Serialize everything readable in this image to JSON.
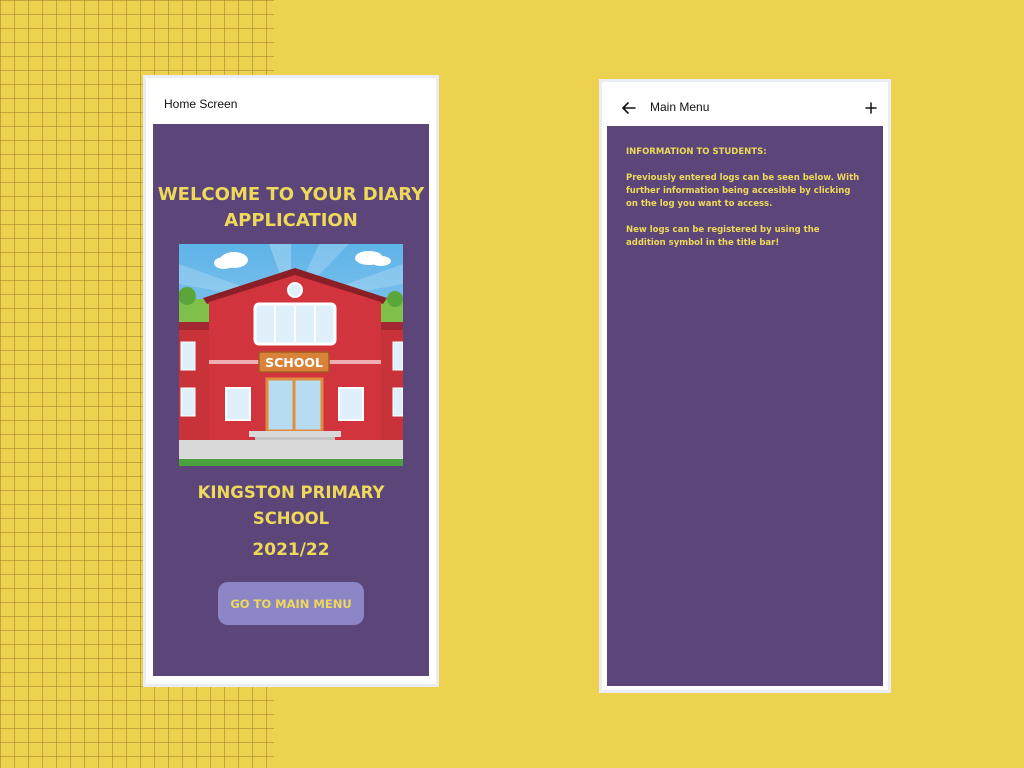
{
  "home_screen": {
    "title": "Home Screen",
    "welcome_line1": "WELCOME TO YOUR DIARY",
    "welcome_line2": "APPLICATION",
    "school_sign": "SCHOOL",
    "school_name_line1": "KINGSTON PRIMARY",
    "school_name_line2": "SCHOOL",
    "year": "2021/22",
    "button_label": "GO TO MAIN MENU"
  },
  "main_menu": {
    "title": "Main Menu",
    "back_icon": "arrow-left-icon",
    "add_icon": "plus-icon",
    "info_heading": "INFORMATION TO STUDENTS:",
    "info_para1": "Previously entered logs can be seen below. With further information being accesible by clicking on the log you want to access.",
    "info_para2": "New logs can be registered by using the addition symbol in the title bar!"
  },
  "colors": {
    "background": "#ecd24f",
    "screen": "#5c4679",
    "text_accent": "#eed95a",
    "button": "#8c86c7"
  }
}
